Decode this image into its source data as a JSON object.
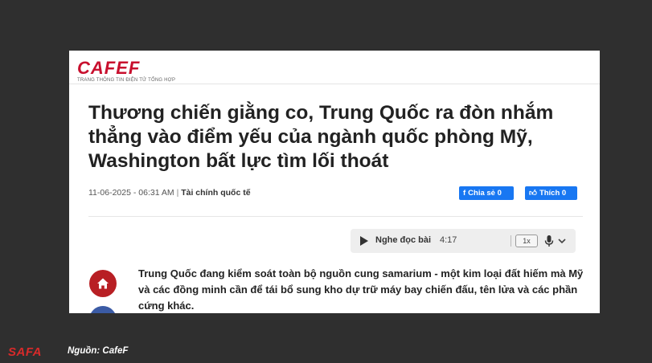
{
  "site": {
    "logo": "CAFEF",
    "tagline": "TRANG THÔNG TIN ĐIỆN TỬ TỔNG HỢP"
  },
  "article": {
    "title": "Thương chiến giằng co, Trung Quốc ra đòn nhắm thẳng vào điểm yếu của ngành quốc phòng Mỹ, Washington bất lực tìm lối thoát",
    "datetime": "11-06-2025 - 06:31 AM",
    "separator": "|",
    "category": "Tài chính quốc tế",
    "sapo": "Trung Quốc đang kiểm soát toàn bộ nguồn cung samarium - một kim loại đất hiếm mà Mỹ và các đồng minh cần để tái bổ sung kho dự trữ máy bay chiến đấu, tên lửa và các phần cứng khác."
  },
  "social": {
    "share_label": "Chia sẻ 0",
    "like_label": "Thích 0",
    "color": "#1877f2"
  },
  "audio": {
    "label": "Nghe đọc bài",
    "duration": "4:17",
    "speed": "1x"
  },
  "footer": {
    "logo": "SAFA",
    "source": "Nguồn: CafeF"
  },
  "icons": {
    "home": "home-icon",
    "play": "play-icon",
    "mic": "mic-icon",
    "chevron": "chevron-down-icon",
    "facebook": "facebook-icon",
    "like": "thumbs-up-icon"
  },
  "colors": {
    "brand_red": "#c8102e",
    "background": "#2f2f2f",
    "home_button": "#b81f24"
  }
}
